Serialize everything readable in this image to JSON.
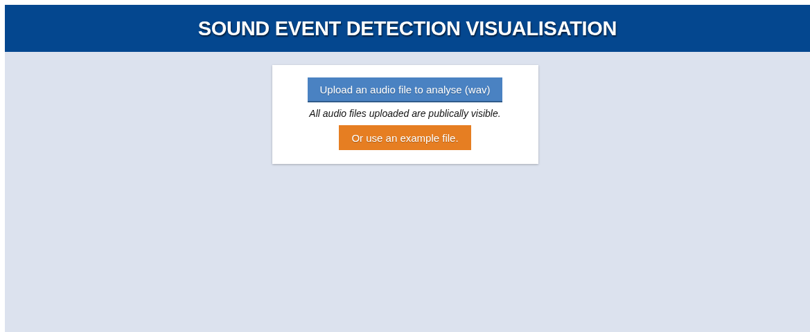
{
  "header": {
    "title": "SOUND EVENT DETECTION VISUALISATION"
  },
  "card": {
    "buttons": [
      {
        "label": "Upload an audio file to analyse (wav)",
        "kind": "upload"
      },
      {
        "kind": "example",
        "label": "Or use an example file."
      }
    ],
    "note": "All audio files uploaded are publically visible."
  }
}
